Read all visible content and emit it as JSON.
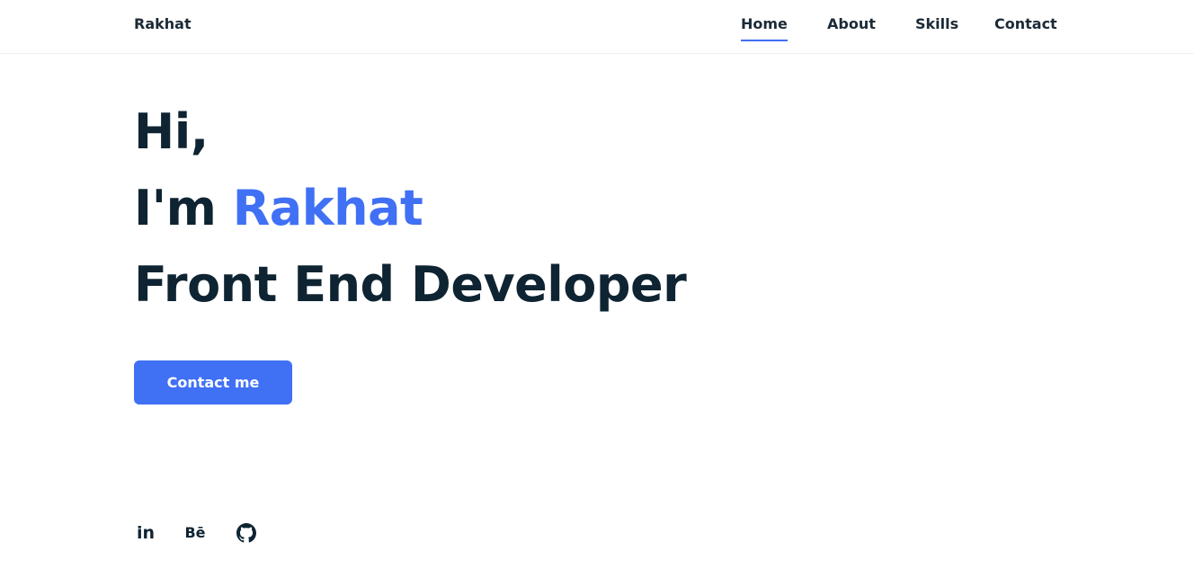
{
  "header": {
    "logo": "Rakhat",
    "nav": [
      {
        "label": "Home",
        "active": true
      },
      {
        "label": "About",
        "active": false
      },
      {
        "label": "Skills",
        "active": false
      },
      {
        "label": "Contact",
        "active": false
      }
    ]
  },
  "hero": {
    "greeting": "Hi,",
    "intro_prefix": "I'm ",
    "name": "Rakhat",
    "role": "Front End Developer",
    "button_label": "Contact me"
  },
  "social": {
    "linkedin": "in",
    "behance": "Bē",
    "icons": [
      "linkedin-icon",
      "behance-icon",
      "github-icon"
    ]
  },
  "colors": {
    "accent": "#4070f4",
    "text": "#0f2432",
    "background": "#ffffff"
  }
}
